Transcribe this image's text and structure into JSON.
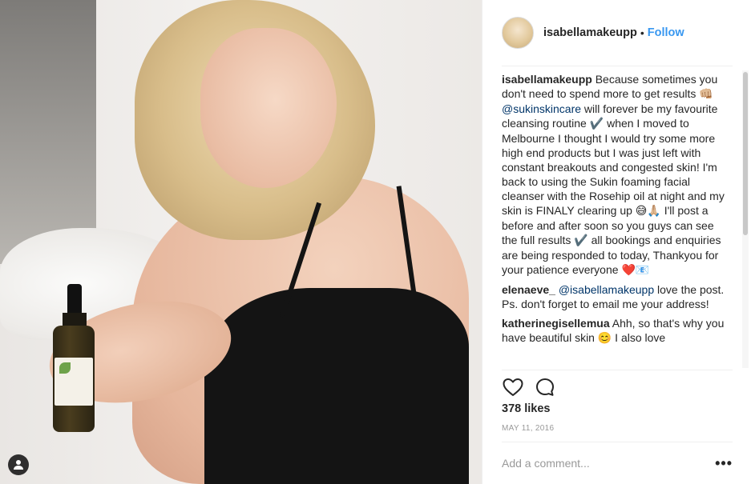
{
  "post": {
    "photo": {
      "user_tag_icon": "person-icon"
    },
    "header": {
      "username": "isabellamakeupp",
      "separator": "•",
      "follow_label": "Follow"
    },
    "caption": {
      "username": "isabellamakeupp",
      "seg1": "Because sometimes you don't need to spend more to get results ",
      "emoji1": "👊🏼",
      "mention": "@sukinskincare",
      "seg2": " will forever be my favourite cleansing routine ",
      "check1": "✔️",
      "seg3": " when I moved to Melbourne I thought I would try some more high end products but I was just left with constant breakouts and congested skin! I'm back to using the Sukin foaming facial cleanser with the Rosehip oil at night and my skin is FINALY clearing up ",
      "emoji2": "😅🙏🏼",
      "seg4": " I'll post a before and after soon so you guys can see the full results ",
      "check2": "✔️",
      "seg5": " all bookings and enquiries are being responded to today, Thankyou for your patience everyone ",
      "emoji3": "❤️📧"
    },
    "comments": [
      {
        "username": "elenaeve_",
        "mention": "@isabellamakeupp",
        "text": " love the post. Ps. don't forget to email me your address!"
      },
      {
        "username": "katherinegisellemua",
        "text": " Ahh, so that's why you have beautiful skin 😊 I also love"
      }
    ],
    "actions": {
      "like_icon": "heart-icon",
      "comment_icon": "comment-icon"
    },
    "likes": "378 likes",
    "date": "MAY 11, 2016",
    "add_comment_placeholder": "Add a comment...",
    "more_label": "•••"
  }
}
